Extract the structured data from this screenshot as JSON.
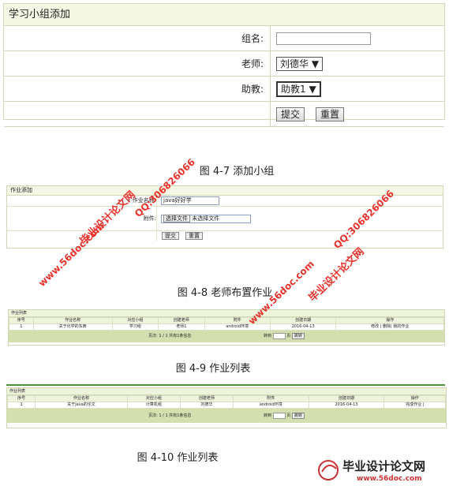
{
  "fig1": {
    "title": "学习小组添加",
    "group_label": "组名:",
    "teacher_label": "老师:",
    "teacher_value": "刘德华",
    "assistant_label": "助教:",
    "assistant_value": "助教1",
    "submit": "提交",
    "reset": "重置",
    "caption": "图 4-7 添加小组"
  },
  "fig2": {
    "title": "作业添加",
    "name_label": "作业名称:",
    "name_value": "java好好学",
    "attach_label": "附件:",
    "choose_file": "选择文件",
    "no_file": "未选择文件",
    "submit": "提交",
    "reset": "重置",
    "caption": "图 4-8 老师布置作业"
  },
  "fig3": {
    "title": "作业列表",
    "headers": [
      "序号",
      "作业名称",
      "对应小组",
      "创建老师",
      "附件",
      "创建日期",
      "操作"
    ],
    "row": [
      "1",
      "关于化学的东西",
      "学习组",
      "老师1",
      "android环境",
      "2016-04-13",
      "修改 | 删除| 我的作业"
    ],
    "pager": "页次: 1 / 1 共有1条信息",
    "goto": "转到",
    "page": "页",
    "go": "跳转",
    "caption": "图 4-9 作业列表"
  },
  "fig4": {
    "title": "作业列表",
    "headers": [
      "序号",
      "作业名称",
      "对应小组",
      "创建老师",
      "附件",
      "创建日期",
      "操作"
    ],
    "row": [
      "1",
      "关于Java的论文",
      "计算机组",
      "刘德华",
      "android环境",
      "2016-04-13",
      "完成作业 |"
    ],
    "pager": "页次: 1 / 1 共有1条信息",
    "goto": "转到",
    "page": "页",
    "go": "跳转",
    "caption": "图 4-10 作业列表"
  },
  "watermarks": {
    "site": "毕业设计论文网",
    "url": "www.56doc.com",
    "qq": "QQ:306826066"
  },
  "logo": {
    "name": "毕业设计论文网",
    "url": "www.56doc.com"
  },
  "colors": {
    "watermark": "#e8322c",
    "header_bg": "#f3f7e3",
    "border": "#cfd9b5",
    "pager_bg": "#d4dfb0"
  }
}
